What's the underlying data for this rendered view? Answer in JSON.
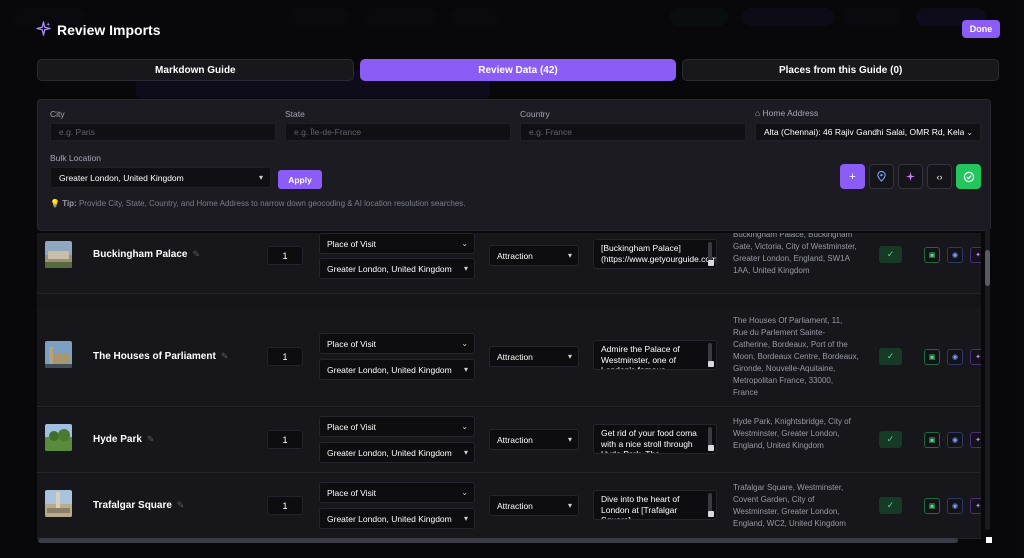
{
  "modal": {
    "title": "Review Imports",
    "done_label": "Done"
  },
  "tabs": [
    {
      "label": "Markdown Guide",
      "active": false
    },
    {
      "label": "Review Data (42)",
      "active": true
    },
    {
      "label": "Places from this Guide (0)",
      "active": false
    }
  ],
  "filters": {
    "city": {
      "label": "City",
      "placeholder": "e.g. Paris"
    },
    "state": {
      "label": "State",
      "placeholder": "e.g. Île-de-France"
    },
    "country": {
      "label": "Country",
      "placeholder": "e.g. France"
    },
    "home_address": {
      "label": "Home Address",
      "value": "Alta (Chennai): 46 Rajiv Gandhi Salai, OMR Rd, Kela"
    },
    "bulk_location": {
      "label": "Bulk Location",
      "value": "Greater London, United Kingdom"
    },
    "apply_label": "Apply",
    "tip_prefix": "Tip:",
    "tip_text": "Provide City, State, Country, and Home Address to narrow down geocoding & AI location resolution searches."
  },
  "toolbar": {
    "icons": [
      "plus-icon",
      "map-pin-icon",
      "sparkle-icon",
      "code-icon",
      "check-circle-icon"
    ]
  },
  "rows": [
    {
      "name": "Buckingham Palace",
      "qty": "1",
      "visit_type": "Place of Visit",
      "location": "Greater London, United Kingdom",
      "category": "Attraction",
      "note": "[Buckingham Palace] (https://www.getyourguide.com/buckingham",
      "address": "Buckingham Palace, Buckingham Gate, Victoria, City of Westminster, Greater London, England, SW1A 1AA, United Kingdom"
    },
    {
      "name": "The Houses of Parliament",
      "qty": "1",
      "visit_type": "Place of Visit",
      "location": "Greater London, United Kingdom",
      "category": "Attraction",
      "note": "Admire the Palace of Westminster, one of London's famous",
      "address": "The Houses Of Parliament, 11, Rue du Parlement Sainte-Catherine, Bordeaux, Port of the Moon, Bordeaux Centre, Bordeaux, Gironde, Nouvelle-Aquitaine, Metropolitan France, 33000, France"
    },
    {
      "name": "Hyde Park",
      "qty": "1",
      "visit_type": "Place of Visit",
      "location": "Greater London, United Kingdom",
      "category": "Attraction",
      "note": "Get rid of your food coma with a nice stroll through Hyde Park. The",
      "address": "Hyde Park, Knightsbridge, City of Westminster, Greater London, England, United Kingdom"
    },
    {
      "name": "Trafalgar Square",
      "qty": "1",
      "visit_type": "Place of Visit",
      "location": "Greater London, United Kingdom",
      "category": "Attraction",
      "note": "Dive into the heart of London at [Trafalgar Square]",
      "address": "Trafalgar Square, Westminster, Covent Garden, City of Westminster, Greater London, England, WC2, United Kingdom"
    }
  ],
  "colors": {
    "accent": "#8b5cf6",
    "success": "#22c55e",
    "panel": "#1c1b22"
  }
}
